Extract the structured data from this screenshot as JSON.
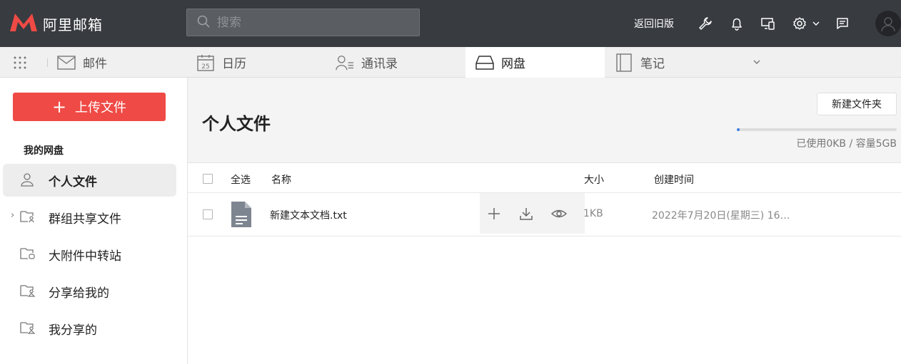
{
  "app": {
    "title": "阿里邮箱"
  },
  "search": {
    "placeholder": "搜索"
  },
  "header": {
    "back_old_label": "返回旧版"
  },
  "modules": [
    {
      "label": "邮件",
      "icon": "mail-icon"
    },
    {
      "label": "日历",
      "icon": "calendar-icon",
      "icon_text": "25"
    },
    {
      "label": "通讯录",
      "icon": "contacts-icon"
    },
    {
      "label": "网盘",
      "icon": "drive-icon",
      "active": true
    },
    {
      "label": "笔记",
      "icon": "notebook-icon"
    }
  ],
  "sidebar": {
    "upload_label": "上传文件",
    "heading": "我的网盘",
    "items": [
      {
        "label": "个人文件",
        "icon": "user-icon",
        "active": true
      },
      {
        "label": "群组共享文件",
        "icon": "group-folder-icon"
      },
      {
        "label": "大附件中转站",
        "icon": "attachment-folder-icon"
      },
      {
        "label": "分享给我的",
        "icon": "shared-folder-icon"
      },
      {
        "label": "我分享的",
        "icon": "shared-folder-icon"
      }
    ]
  },
  "main": {
    "title": "个人文件",
    "new_folder_label": "新建文件夹",
    "quota_text": "已使用0KB / 容量5GB",
    "quota_fraction": 0.02
  },
  "table": {
    "columns": {
      "select_all": "全选",
      "name": "名称",
      "size": "大小",
      "created": "创建时间"
    },
    "rows": [
      {
        "name": "新建文本文档.txt",
        "size": "1KB",
        "created": "2022年7月20日(星期三) 16…"
      }
    ]
  },
  "colors": {
    "topbar": "#383b40",
    "accent_red": "#ef4a45",
    "quota_blue": "#3a7be0"
  }
}
